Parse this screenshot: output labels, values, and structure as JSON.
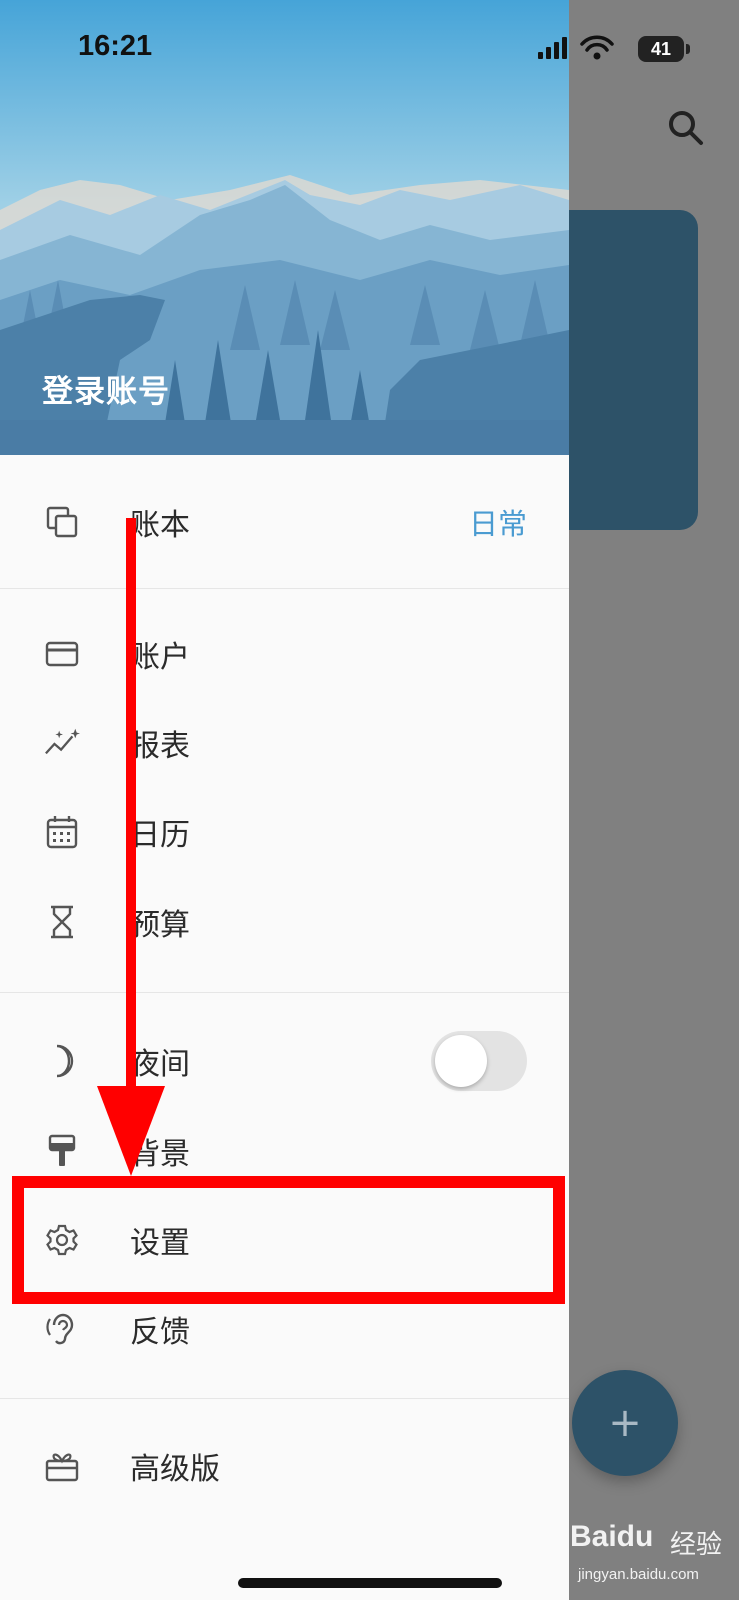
{
  "status_bar": {
    "time": "16:21",
    "battery": "41"
  },
  "header": {
    "login_label": "登录账号"
  },
  "menu": {
    "ledger": {
      "label": "账本",
      "value": "日常",
      "icon": "copy-icon"
    },
    "accounts": {
      "label": "账户",
      "icon": "card-icon"
    },
    "reports": {
      "label": "报表",
      "icon": "chart-sparkle-icon"
    },
    "calendar": {
      "label": "日历",
      "icon": "calendar-icon"
    },
    "budget": {
      "label": "预算",
      "icon": "hourglass-icon"
    },
    "night": {
      "label": "夜间",
      "icon": "moon-icon",
      "toggle_on": false
    },
    "background": {
      "label": "背景",
      "icon": "paint-roller-icon"
    },
    "settings": {
      "label": "设置",
      "icon": "gear-icon"
    },
    "feedback": {
      "label": "反馈",
      "icon": "ear-icon"
    },
    "premium": {
      "label": "高级版",
      "icon": "gift-icon"
    }
  },
  "fab": {
    "label": "+"
  },
  "watermark": {
    "logo": "Baidu",
    "cn": "经验",
    "url": "jingyan.baidu.com"
  },
  "colors": {
    "accent": "#4a9bd1",
    "card": "#2d5268",
    "highlight": "#ff0000"
  }
}
